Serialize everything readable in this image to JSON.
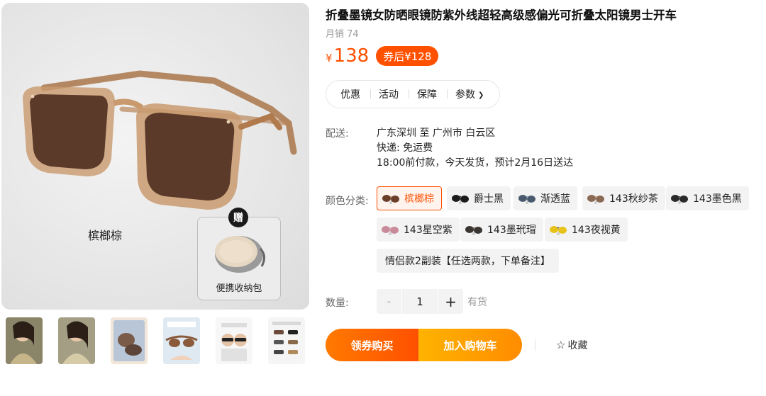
{
  "product": {
    "title": "折叠墨镜女防晒眼镜防紫外线超轻高级感偏光可折叠太阳镜男士开车",
    "sales": "月销 74",
    "price_symbol": "¥",
    "price": "138",
    "coupon_price": "券后¥128"
  },
  "gallery": {
    "main_color_caption": "槟榔棕",
    "gift_badge": "赠",
    "gift_caption": "便携收纳包",
    "thumbnails": [
      "thumb-1",
      "thumb-2",
      "thumb-3",
      "thumb-4",
      "thumb-5",
      "thumb-6"
    ]
  },
  "tabs": [
    "优惠",
    "活动",
    "保障",
    "参数"
  ],
  "shipping": {
    "label": "配送:",
    "route": "广东深圳 至 广州市 白云区",
    "express": "快递: 免运费",
    "eta": "18:00前付款，今天发货，预计2月16日送达"
  },
  "colors": {
    "label": "颜色分类:",
    "options": [
      "槟榔棕",
      "爵士黑",
      "渐透蓝",
      "143秋纱茶",
      "143墨色黑",
      "143星空紫",
      "143墨玳瑁",
      "143夜视黄",
      "情侣款2副装【任选两款，下单备注】"
    ],
    "selected": "槟榔棕"
  },
  "quantity": {
    "label": "数量:",
    "minus": "-",
    "value": "1",
    "plus": "+",
    "stock": "有货"
  },
  "actions": {
    "buy": "领券购买",
    "cart": "加入购物车",
    "favorite_star": "☆",
    "favorite": "收藏"
  },
  "accent_color": "#ff5000"
}
